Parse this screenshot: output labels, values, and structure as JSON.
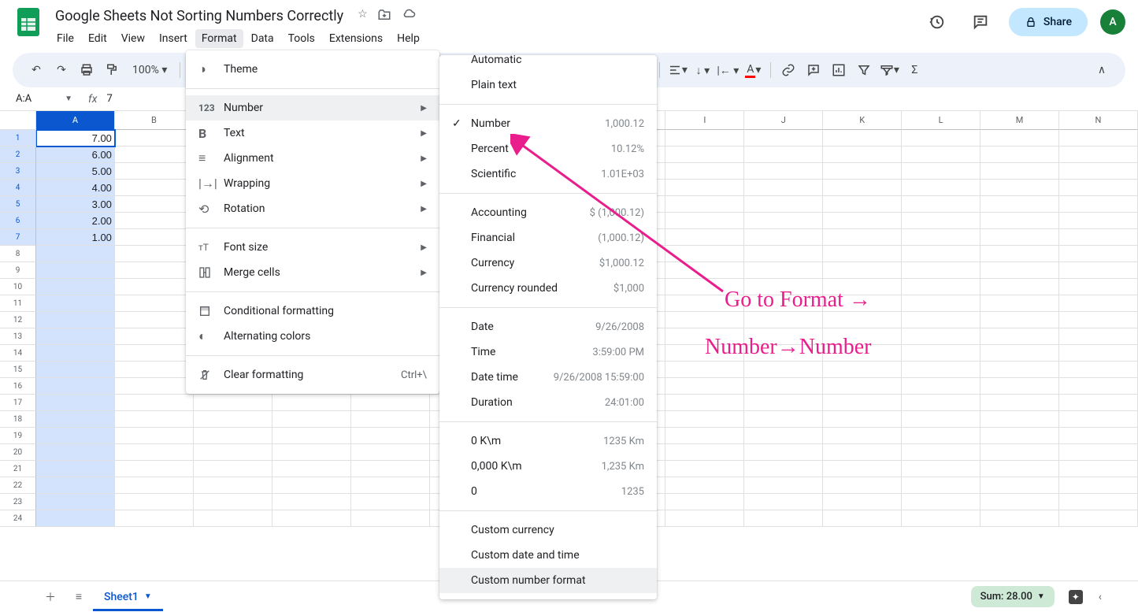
{
  "doc_title": "Google Sheets Not Sorting Numbers Correctly",
  "menu": [
    "File",
    "Edit",
    "View",
    "Insert",
    "Format",
    "Data",
    "Tools",
    "Extensions",
    "Help"
  ],
  "active_menu": "Format",
  "share_label": "Share",
  "avatar": "A",
  "zoom": "100%",
  "name_box": "A:A",
  "formula_value": "7",
  "columns": [
    "A",
    "B",
    "C",
    "D",
    "E",
    "F",
    "G",
    "H",
    "I",
    "J",
    "K",
    "L",
    "M",
    "N"
  ],
  "rows": 24,
  "cell_data": [
    "7.00",
    "6.00",
    "5.00",
    "4.00",
    "3.00",
    "2.00",
    "1.00"
  ],
  "sheet_tab": "Sheet1",
  "sum_label": "Sum: 28.00",
  "format_menu": {
    "theme": "Theme",
    "number": "Number",
    "text": "Text",
    "alignment": "Alignment",
    "wrapping": "Wrapping",
    "rotation": "Rotation",
    "font_size": "Font size",
    "merge": "Merge cells",
    "conditional": "Conditional formatting",
    "alternating": "Alternating colors",
    "clear": "Clear formatting",
    "clear_shortcut": "Ctrl+\\"
  },
  "number_menu": [
    {
      "label": "Automatic",
      "example": "",
      "check": false,
      "group": 0,
      "cutTop": true
    },
    {
      "label": "Plain text",
      "example": "",
      "check": false,
      "group": 0
    },
    {
      "label": "Number",
      "example": "1,000.12",
      "check": true,
      "group": 1
    },
    {
      "label": "Percent",
      "example": "10.12%",
      "check": false,
      "group": 1
    },
    {
      "label": "Scientific",
      "example": "1.01E+03",
      "check": false,
      "group": 1
    },
    {
      "label": "Accounting",
      "example": "$ (1,000.12)",
      "check": false,
      "group": 2
    },
    {
      "label": "Financial",
      "example": "(1,000.12)",
      "check": false,
      "group": 2
    },
    {
      "label": "Currency",
      "example": "$1,000.12",
      "check": false,
      "group": 2
    },
    {
      "label": "Currency rounded",
      "example": "$1,000",
      "check": false,
      "group": 2
    },
    {
      "label": "Date",
      "example": "9/26/2008",
      "check": false,
      "group": 3
    },
    {
      "label": "Time",
      "example": "3:59:00 PM",
      "check": false,
      "group": 3
    },
    {
      "label": "Date time",
      "example": "9/26/2008 15:59:00",
      "check": false,
      "group": 3
    },
    {
      "label": "Duration",
      "example": "24:01:00",
      "check": false,
      "group": 3
    },
    {
      "label": "0 K\\m",
      "example": "1235 Km",
      "check": false,
      "group": 4
    },
    {
      "label": "0,000 K\\m",
      "example": "1,235 Km",
      "check": false,
      "group": 4
    },
    {
      "label": "0",
      "example": "1235",
      "check": false,
      "group": 4
    },
    {
      "label": "Custom currency",
      "example": "",
      "check": false,
      "group": 5
    },
    {
      "label": "Custom date and time",
      "example": "",
      "check": false,
      "group": 5
    },
    {
      "label": "Custom number format",
      "example": "",
      "check": false,
      "group": 5,
      "hover": true
    }
  ],
  "annotation_lines": [
    "Go to Format →",
    "Number→Number"
  ]
}
